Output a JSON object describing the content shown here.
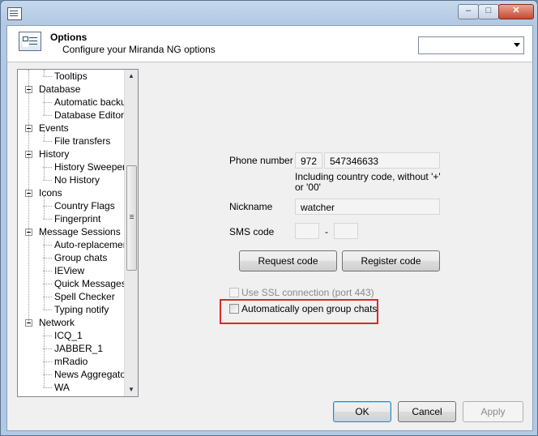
{
  "window": {
    "close_glyph": "✕",
    "max_glyph": "□",
    "min_glyph": "–"
  },
  "header": {
    "title": "Options",
    "subtitle": "Configure your Miranda NG options",
    "select_value": ""
  },
  "tree": {
    "items": [
      {
        "label": "Tooltips",
        "level": 1
      },
      {
        "label": "Database",
        "level": 0
      },
      {
        "label": "Automatic backups",
        "level": 1
      },
      {
        "label": "Database Editor++",
        "level": 1
      },
      {
        "label": "Events",
        "level": 0
      },
      {
        "label": "File transfers",
        "level": 1
      },
      {
        "label": "History",
        "level": 0
      },
      {
        "label": "History Sweeper Li",
        "level": 1
      },
      {
        "label": "No History",
        "level": 1
      },
      {
        "label": "Icons",
        "level": 0
      },
      {
        "label": "Country Flags",
        "level": 1
      },
      {
        "label": "Fingerprint",
        "level": 1
      },
      {
        "label": "Message Sessions",
        "level": 0
      },
      {
        "label": "Auto-replacements",
        "level": 1
      },
      {
        "label": "Group chats",
        "level": 1
      },
      {
        "label": "IEView",
        "level": 1
      },
      {
        "label": "Quick Messages",
        "level": 1
      },
      {
        "label": "Spell Checker",
        "level": 1
      },
      {
        "label": "Typing notify",
        "level": 1
      },
      {
        "label": "Network",
        "level": 0
      },
      {
        "label": "ICQ_1",
        "level": 1
      },
      {
        "label": "JABBER_1",
        "level": 1
      },
      {
        "label": "mRadio",
        "level": 1
      },
      {
        "label": "News Aggregator",
        "level": 1
      },
      {
        "label": "WA",
        "level": 1
      }
    ]
  },
  "form": {
    "phone_label": "Phone number",
    "country_code": "972",
    "phone_value": "547346633",
    "phone_hint": "Including country code, without '+' or '00'",
    "nickname_label": "Nickname",
    "nickname_value": "watcher",
    "sms_label": "SMS code",
    "sms_dash": "-",
    "request_code": "Request code",
    "register_code": "Register code",
    "ssl_label": "Use SSL connection (port 443)",
    "auto_open_label": "Automatically open group chats"
  },
  "footer": {
    "ok": "OK",
    "cancel": "Cancel",
    "apply": "Apply"
  }
}
